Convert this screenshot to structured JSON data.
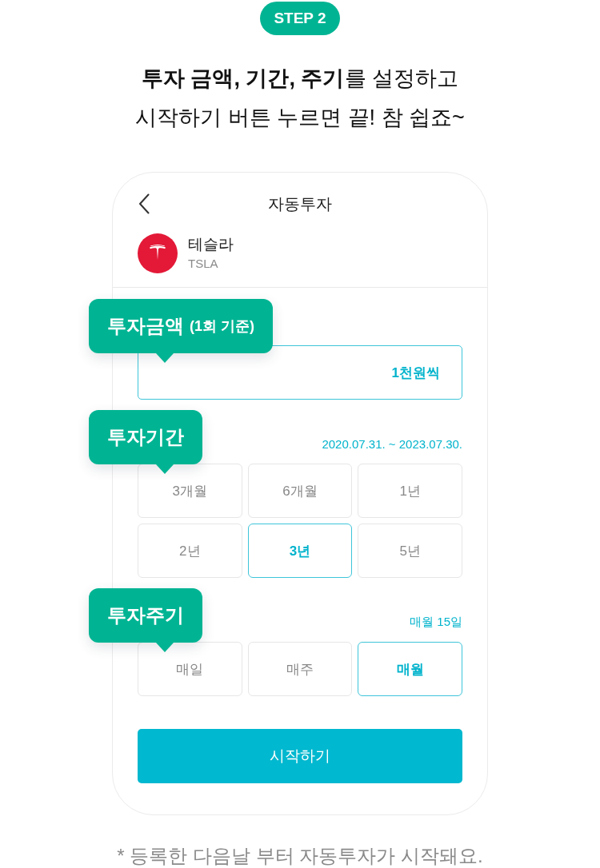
{
  "step_badge": "STEP 2",
  "headline": [
    "**투자 금액, 기간, 주기**를 설정하고",
    "시작하기 버튼 누르면 끝! 참 쉽죠~"
  ],
  "phone": {
    "title": "자동투자",
    "stock": {
      "name": "테슬라",
      "ticker": "TSLA"
    },
    "amount": {
      "tooltip": {
        "label": "투자금액",
        "note": "(1회 기준)"
      },
      "value": "1천원씩"
    },
    "period": {
      "tooltip": {
        "label": "투자기간"
      },
      "range": "2020.07.31. ~ 2023.07.30.",
      "options": [
        {
          "label": "3개월",
          "selected": false
        },
        {
          "label": "6개월",
          "selected": false
        },
        {
          "label": "1년",
          "selected": false
        },
        {
          "label": "2년",
          "selected": false
        },
        {
          "label": "3년",
          "selected": true
        },
        {
          "label": "5년",
          "selected": false
        }
      ]
    },
    "cycle": {
      "tooltip": {
        "label": "투자주기"
      },
      "schedule": "매월 15일",
      "options": [
        {
          "label": "매일",
          "selected": false
        },
        {
          "label": "매주",
          "selected": false
        },
        {
          "label": "매월",
          "selected": true
        }
      ]
    },
    "start_button": "시작하기"
  },
  "footnote": "* 등록한 다음날 부터 자동투자가 시작돼요."
}
